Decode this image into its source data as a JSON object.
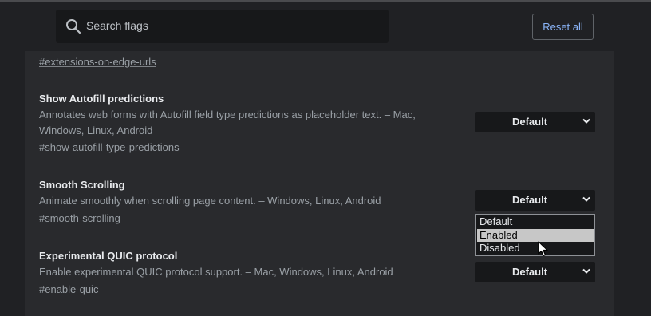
{
  "search": {
    "placeholder": "Search flags"
  },
  "reset_label": "Reset all",
  "top_link": "#extensions-on-edge-urls",
  "flags": [
    {
      "title": "Show Autofill predictions",
      "desc_line1": "Annotates web forms with Autofill field type predictions as placeholder text. – Mac,",
      "desc_line2": "Windows, Linux, Android",
      "link": "#show-autofill-type-predictions",
      "value": "Default"
    },
    {
      "title": "Smooth Scrolling",
      "desc_line1": "Animate smoothly when scrolling page content. – Windows, Linux, Android",
      "link": "#smooth-scrolling",
      "value": "Default"
    },
    {
      "title": "Experimental QUIC protocol",
      "desc_line1": "Enable experimental QUIC protocol support. – Mac, Windows, Linux, Android",
      "link": "#enable-quic",
      "value": "Default"
    }
  ],
  "dropdown_options": [
    "Default",
    "Enabled",
    "Disabled"
  ],
  "highlighted_option": "Enabled",
  "colors": {
    "accent": "#8ab4f8",
    "background": "#202124",
    "panel": "#292a2d"
  }
}
